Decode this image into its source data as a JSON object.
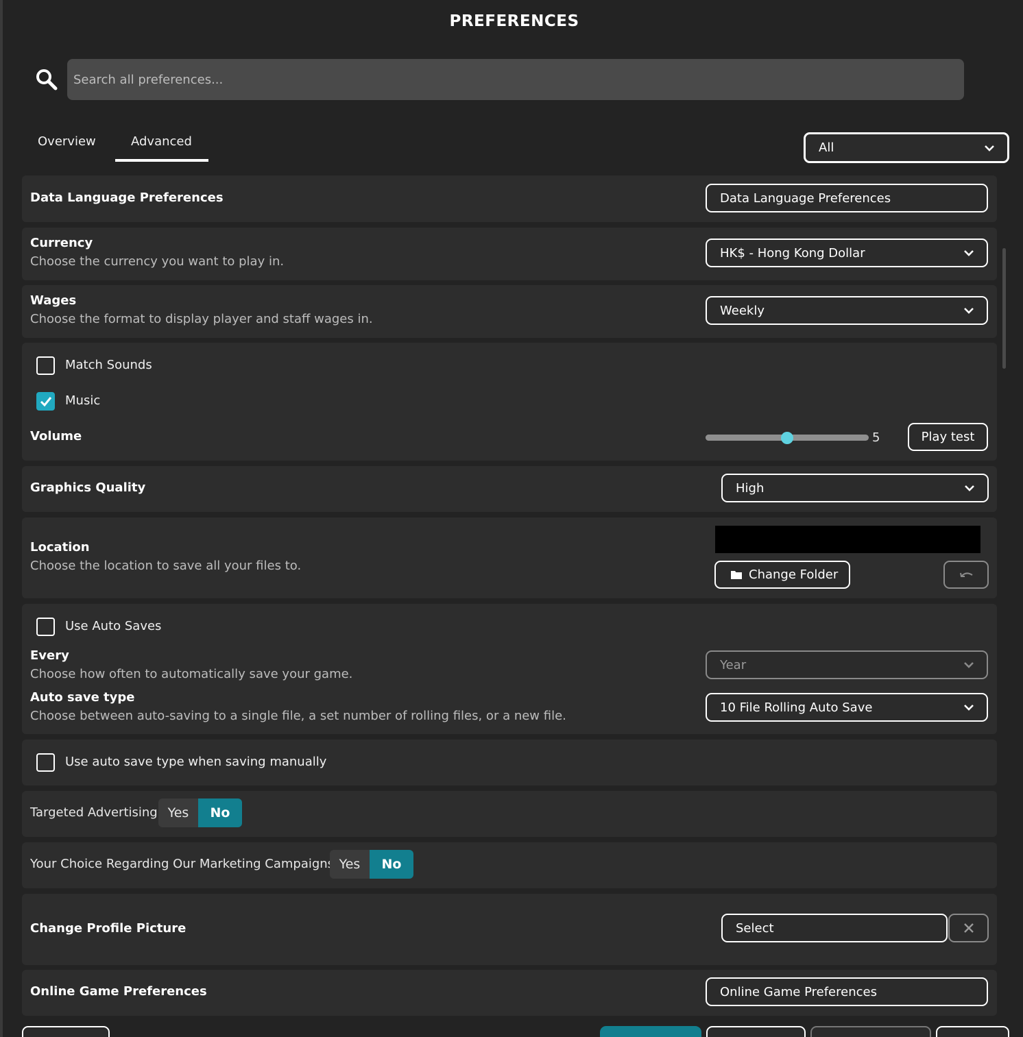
{
  "window": {
    "title": "PREFERENCES"
  },
  "search": {
    "placeholder": "Search all preferences..."
  },
  "tabs": [
    {
      "label": "Overview",
      "active": false
    },
    {
      "label": "Advanced",
      "active": true
    }
  ],
  "filter": {
    "selected": "All"
  },
  "data_language": {
    "heading": "Data Language Preferences",
    "button_label": "Data Language Preferences"
  },
  "currency": {
    "heading": "Currency",
    "description": "Choose the currency you want to play in.",
    "selected": "HK$ - Hong Kong Dollar"
  },
  "wages": {
    "heading": "Wages",
    "description": "Choose the format to display player and staff wages in.",
    "selected": "Weekly"
  },
  "sound": {
    "match_sounds": {
      "label": "Match Sounds",
      "checked": false
    },
    "music": {
      "label": "Music",
      "checked": true
    },
    "volume": {
      "label": "Volume",
      "value": 5,
      "min": 0,
      "max": 10,
      "value_text": "5"
    },
    "play_test_label": "Play test"
  },
  "graphics": {
    "heading": "Graphics Quality",
    "selected": "High"
  },
  "location": {
    "heading": "Location",
    "description": "Choose the location to save all your files to.",
    "change_folder_label": "Change Folder"
  },
  "autosave": {
    "use_auto_saves": {
      "label": "Use Auto Saves",
      "checked": false
    },
    "every": {
      "heading": "Every",
      "description": "Choose how often to automatically save your game.",
      "selected": "Year"
    },
    "type": {
      "heading": "Auto save type",
      "description": "Choose between auto-saving to a single file, a set number of rolling files, or a new file.",
      "selected": "10 File Rolling Auto Save"
    },
    "manual": {
      "label": "Use auto save type when saving manually",
      "checked": false
    }
  },
  "targeted_advertising": {
    "label": "Targeted Advertising",
    "yes": "Yes",
    "no": "No",
    "value": "No"
  },
  "marketing": {
    "label": "Your Choice Regarding Our Marketing Campaigns",
    "yes": "Yes",
    "no": "No",
    "value": "No"
  },
  "profile_picture": {
    "heading": "Change Profile Picture",
    "select_label": "Select"
  },
  "online": {
    "heading": "Online Game Preferences",
    "button_label": "Online Game Preferences"
  },
  "colors": {
    "accent": "#21a9c0",
    "toggle_on": "#127f8f",
    "background": "#232323",
    "card": "#2d2d2d"
  }
}
